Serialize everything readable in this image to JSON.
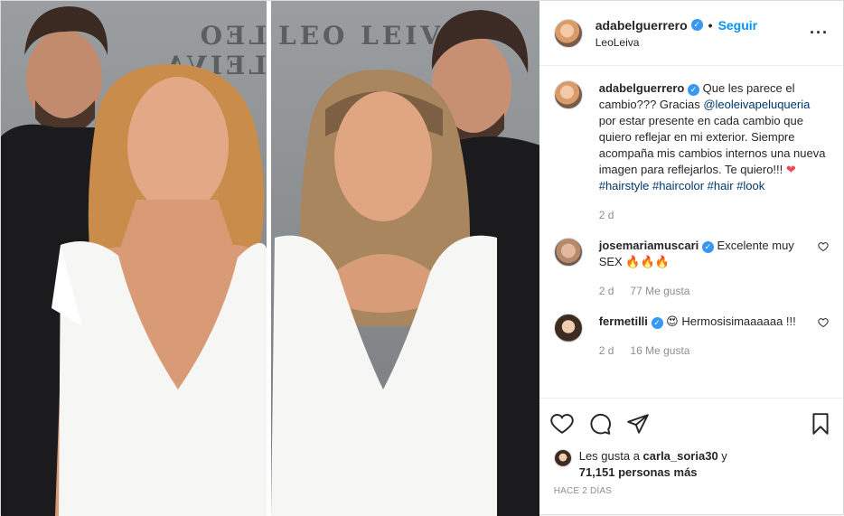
{
  "post": {
    "author": "adabelguerrero",
    "follow_label": "Seguir",
    "location": "LeoLeiva",
    "sign_text": "LEO LEIVA"
  },
  "caption": {
    "username": "adabelguerrero",
    "text_before_mention": "Que les parece el cambio??? Gracias ",
    "mention": "@leoleivapeluqueria",
    "text_after_mention": " por estar presente en cada cambio que quiero reflejar en mi exterior. Siempre acompaña mis cambios internos una nueva imagen para reflejarlos. Te quiero!!! ",
    "emoji": "❤",
    "hashtags": "#hairstyle #haircolor #hair #look",
    "time": "2 d"
  },
  "comments": [
    {
      "username": "josemariamuscari",
      "text": "Excelente muy SEX 🔥🔥🔥",
      "time": "2 d",
      "likes": "77 Me gusta"
    },
    {
      "username": "fermetilli",
      "text": "😍 Hermosisimaaaaaa !!!",
      "time": "2 d",
      "likes": "16 Me gusta"
    }
  ],
  "likes": {
    "prefix": "Les gusta a ",
    "user": "carla_soria30",
    "middle": " y",
    "count": "71,151 personas más"
  },
  "date_label": "HACE 2 DÍAS",
  "icons": [
    "heart-icon",
    "comment-icon",
    "share-icon",
    "bookmark-icon",
    "more-options-icon",
    "verified-badge-icon"
  ],
  "colors": {
    "link": "#00376b",
    "follow": "#0095f6",
    "verified": "#3897f0",
    "meta": "#8e8e8e",
    "heart": "#ed4956"
  }
}
